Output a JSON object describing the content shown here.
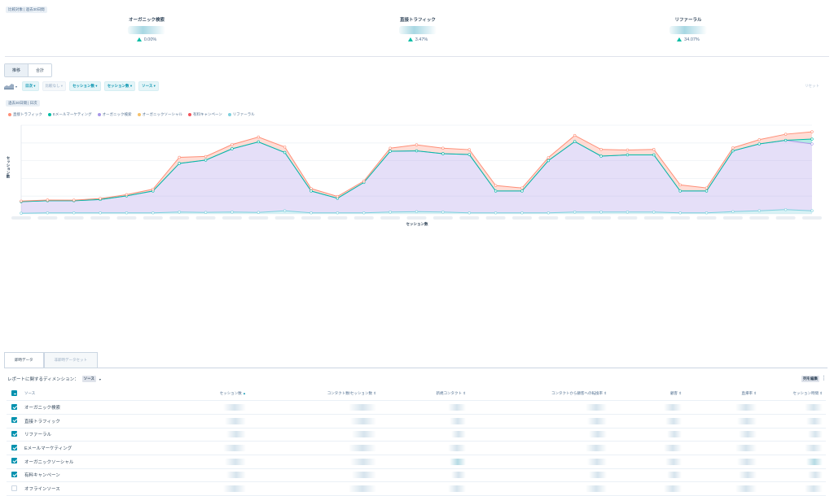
{
  "header": {
    "range_tag": "比較対象 | 過去30日間"
  },
  "kpis": [
    {
      "title": "オーガニック検索",
      "change": "0.00%"
    },
    {
      "title": "直接トラフィック",
      "change": "3.47%"
    },
    {
      "title": "リファーラル",
      "change": "34.07%"
    }
  ],
  "view_toggle": {
    "items": [
      "推移",
      "合計"
    ],
    "active": 0
  },
  "filters": {
    "chart_icon": "area-chart-icon",
    "chips": [
      {
        "label": "日次",
        "muted": false
      },
      {
        "label": "比較なし",
        "muted": true
      },
      {
        "label": "セッション数",
        "muted": false
      },
      {
        "label": "セッション数",
        "muted": false
      },
      {
        "label": "ソース",
        "muted": false
      }
    ],
    "reset_label": "リセット"
  },
  "chart_tag": "過去30日間 | 日次",
  "chart_data": {
    "type": "area",
    "stacked": true,
    "ylabel": "セッション数",
    "xlabel": "セッション数",
    "grid": true,
    "legend_position": "top-left",
    "series": [
      {
        "name": "直接トラフィック",
        "color": "#ff8f77",
        "values": [
          0.5,
          0.6,
          0.5,
          0.8,
          1.0,
          1.5,
          5.0,
          3.0,
          3.5,
          4.0,
          4.5,
          2.0,
          1.5,
          1.2,
          2.5,
          5.0,
          4.5,
          4.0,
          4.5,
          2.5,
          2.5,
          5.0,
          5.5,
          4.0,
          4.5,
          5.0,
          2.5,
          2.5,
          3.5,
          5.0,
          6.0
        ]
      },
      {
        "name": "Eメールマーケティング",
        "color": "#00bda5",
        "values": [
          0,
          0,
          0,
          0,
          0,
          0,
          0,
          0,
          0,
          0,
          0,
          0,
          0,
          0,
          0,
          0,
          0,
          0,
          0,
          0,
          0,
          0,
          0,
          0,
          0,
          0,
          0,
          0,
          0,
          0,
          4.0
        ]
      },
      {
        "name": "オーガニック検索",
        "color": "#a896e8",
        "values": [
          9.5,
          10.0,
          10.0,
          11.0,
          14.0,
          18.0,
          40.0,
          43.0,
          52.0,
          58.0,
          48.0,
          18.0,
          12.0,
          25.0,
          50.0,
          50.0,
          48.0,
          48.0,
          18.0,
          18.0,
          43.0,
          58.0,
          46.0,
          47.0,
          47.0,
          18.0,
          18.0,
          50.0,
          55.0,
          57.0,
          55.0
        ]
      },
      {
        "name": "オーガニックソーシャル",
        "color": "#f5c26b",
        "values": [
          0,
          0,
          0,
          0,
          0,
          0,
          0,
          0,
          0,
          0,
          0,
          0,
          0,
          0,
          0,
          0,
          0,
          0,
          0,
          0,
          0,
          0,
          0,
          0,
          0,
          0,
          0,
          0,
          0,
          0,
          0
        ]
      },
      {
        "name": "有料キャンペーン",
        "color": "#f2545b",
        "values": [
          0,
          0,
          0,
          0,
          0,
          0,
          0,
          0,
          0,
          0,
          0,
          0,
          0,
          0,
          0,
          0,
          0,
          0,
          0,
          0,
          0,
          0,
          0,
          0,
          0,
          0,
          0,
          0,
          0,
          0,
          0
        ]
      },
      {
        "name": "リファーラル",
        "color": "#7fd1de",
        "values": [
          0.5,
          0.8,
          0.8,
          0.8,
          0.8,
          0.8,
          1.5,
          1.2,
          1.5,
          1.2,
          2.5,
          0.8,
          0.8,
          0.8,
          1.5,
          1.8,
          1.5,
          0.8,
          0.8,
          0.8,
          0.8,
          1.5,
          1.5,
          1.5,
          1.5,
          0.8,
          0.8,
          1.8,
          2.5,
          3.5,
          2.5
        ]
      }
    ]
  },
  "tabs": [
    {
      "label": "即時データ",
      "active": true
    },
    {
      "label": "非即時データセット",
      "active": false
    }
  ],
  "dimension": {
    "label": "レポートに関するディメンション：",
    "value": "ソース"
  },
  "edit_columns_label": "列を編集",
  "table": {
    "columns": [
      "ソース",
      "セッション数",
      "コンタクト数/セッション数",
      "新規コンタクト",
      "コンタクトから顧客への転換率",
      "顧客",
      "直帰率",
      "セッション時間"
    ],
    "rows": [
      {
        "source": "オーガニック検索",
        "checked": true
      },
      {
        "source": "直接トラフィック",
        "checked": true
      },
      {
        "source": "リファーラル",
        "checked": true
      },
      {
        "source": "Eメールマーケティング",
        "checked": true
      },
      {
        "source": "オーガニックソーシャル",
        "checked": true
      },
      {
        "source": "有料キャンペーン",
        "checked": true
      },
      {
        "source": "オフラインソース",
        "checked": false
      }
    ]
  }
}
